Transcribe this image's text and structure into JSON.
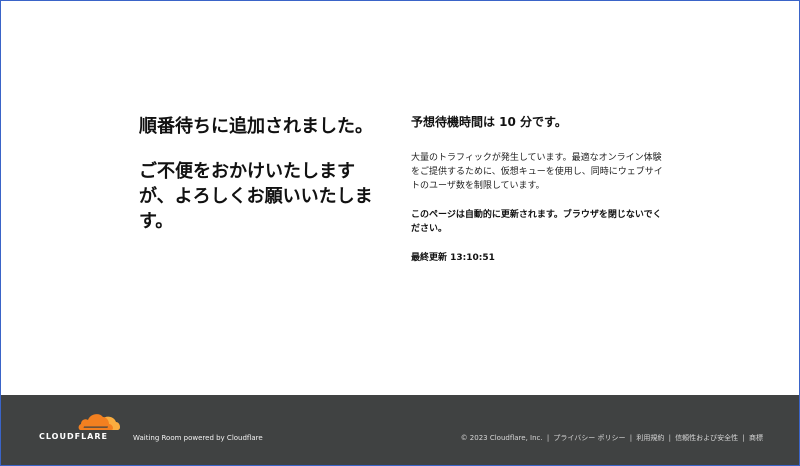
{
  "left": {
    "headline_1": "順番待ちに追加されました。",
    "headline_2": "ご不便をおかけいたしますが、よろしくお願いいたします。"
  },
  "right": {
    "wait_time": "予想待機時間は 10 分です。",
    "description": "大量のトラフィックが発生しています。最適なオンライン体験をご提供するために、仮想キューを使用し、同時にウェブサイトのユーザ数を制限しています。",
    "notice": "このページは自動的に更新されます。ブラウザを閉じないでください。",
    "last_updated": "最終更新 13:10:51"
  },
  "footer": {
    "logo_text": "CLOUDFLARE",
    "powered_by": "Waiting Room powered by Cloudflare",
    "copyright": "© 2023 Cloudflare, Inc.",
    "links": [
      "プライバシー ポリシー",
      "利用規約",
      "信頼性および安全性",
      "商標"
    ],
    "separator": "|"
  },
  "icons": {
    "logo": "cloudflare-cloud-icon"
  },
  "colors": {
    "footer_background": "#404242",
    "cloud_orange": "#f38020",
    "cloud_light_orange": "#faad3f",
    "frame_border": "#3a64c8"
  }
}
